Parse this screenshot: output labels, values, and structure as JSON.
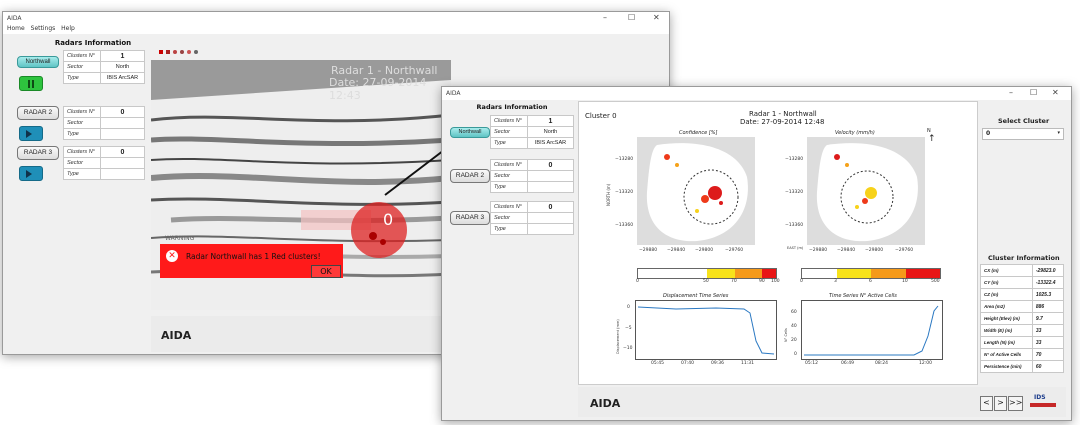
{
  "window1": {
    "title": "AIDA",
    "menu": [
      "Home",
      "Settings",
      "Help"
    ],
    "controls": [
      "–",
      "☐",
      "✕"
    ],
    "radars_title": "Radars Information",
    "radars": [
      {
        "button": "Northwall",
        "clusters_label": "Clusters N°",
        "clusters": "1",
        "sector_label": "Sector",
        "sector": "North",
        "type_label": "Type",
        "type": "IBIS ArcSAR",
        "control": "pause"
      },
      {
        "button": "RADAR 2",
        "clusters_label": "Clusters N°",
        "clusters": "0",
        "sector_label": "Sector",
        "sector": "",
        "type_label": "Type",
        "type": "",
        "control": "play"
      },
      {
        "button": "RADAR 3",
        "clusters_label": "Clusters N°",
        "clusters": "0",
        "sector_label": "Sector",
        "sector": "",
        "type_label": "Type",
        "type": "",
        "control": "play"
      }
    ],
    "view_header": "Radar 1 - Northwall",
    "view_date": "Date: 27-09-2014 12:43",
    "cluster_marker": "0",
    "warning_label": "WARNING",
    "alert_message": "Radar Northwall has 1 Red clusters!",
    "alert_ok": "OK",
    "logo": "AIDA"
  },
  "window2": {
    "title": "AIDA",
    "controls": [
      "–",
      "☐",
      "✕"
    ],
    "radars_title": "Radars Information",
    "radars": [
      {
        "button": "Northwall",
        "clusters_label": "Clusters N°",
        "clusters": "1",
        "sector_label": "Sector",
        "sector": "North",
        "type_label": "Type",
        "type": "IBIS ArcSAR"
      },
      {
        "button": "RADAR 2",
        "clusters_label": "Clusters N°",
        "clusters": "0",
        "sector_label": "Sector",
        "sector": "",
        "type_label": "Type",
        "type": ""
      },
      {
        "button": "RADAR 3",
        "clusters_label": "Clusters N°",
        "clusters": "0",
        "sector_label": "Sector",
        "sector": "",
        "type_label": "Type",
        "type": ""
      }
    ],
    "cluster_label": "Cluster 0",
    "plot_title": "Radar 1 - Northwall",
    "plot_date": "Date: 27-09-2014 12:48",
    "north": "N",
    "map1_title": "Confidence  [%]",
    "map2_title": "Velocity  (mm/h)",
    "map_yticks": [
      "−13280",
      "−13320",
      "−13360"
    ],
    "map_xticks": [
      "−29880",
      "−29840",
      "−29800",
      "−29760"
    ],
    "map1_ylabel": "NORTH (m)",
    "map2_xlabel_side": "EAST (m)",
    "cbar1_ticks": [
      "0",
      "50",
      "70",
      "90",
      "100"
    ],
    "cbar2_ticks": [
      "0",
      "3",
      "6",
      "10",
      "500"
    ],
    "ts1_title": "Displacement Time Series",
    "ts1_ylabel": "Displacement (mm)",
    "ts1_yticks": [
      "0",
      "−5",
      "−10"
    ],
    "ts1_xticks": [
      "05:45",
      "07:40",
      "09:36",
      "11:31"
    ],
    "ts2_title": "Time Series N° Active Cells",
    "ts2_ylabel": "N° Cells",
    "ts2_yticks": [
      "60",
      "40",
      "20",
      "0"
    ],
    "ts2_xticks": [
      "05:12",
      "06:49",
      "08:24",
      "12:00"
    ],
    "select_cluster_label": "Select Cluster",
    "select_cluster_value": "0",
    "cluster_info_title": "Cluster Information",
    "cluster_info": [
      {
        "label": "CX (m)",
        "value": "-29823.0"
      },
      {
        "label": "CY (m)",
        "value": "-13322.4"
      },
      {
        "label": "CZ (m)",
        "value": "1025.3"
      },
      {
        "label": "Area (m2)",
        "value": "886"
      },
      {
        "label": "Height (Elev) (m)",
        "value": "9.7"
      },
      {
        "label": "Width (E) (m)",
        "value": "33"
      },
      {
        "label": "Length (N) (m)",
        "value": "33"
      },
      {
        "label": "N° of Active Cells",
        "value": "70"
      },
      {
        "label": "Persistence (min)",
        "value": "60"
      }
    ],
    "logo": "AIDA",
    "nav": [
      "<",
      ">",
      ">>"
    ],
    "partner_logo": "IDS"
  },
  "colors": {
    "alert_red": "#ff1a1a",
    "selected_button": "#7fd9d9",
    "play_blue": "#1f8fb8",
    "pause_green": "#2ec33e"
  }
}
